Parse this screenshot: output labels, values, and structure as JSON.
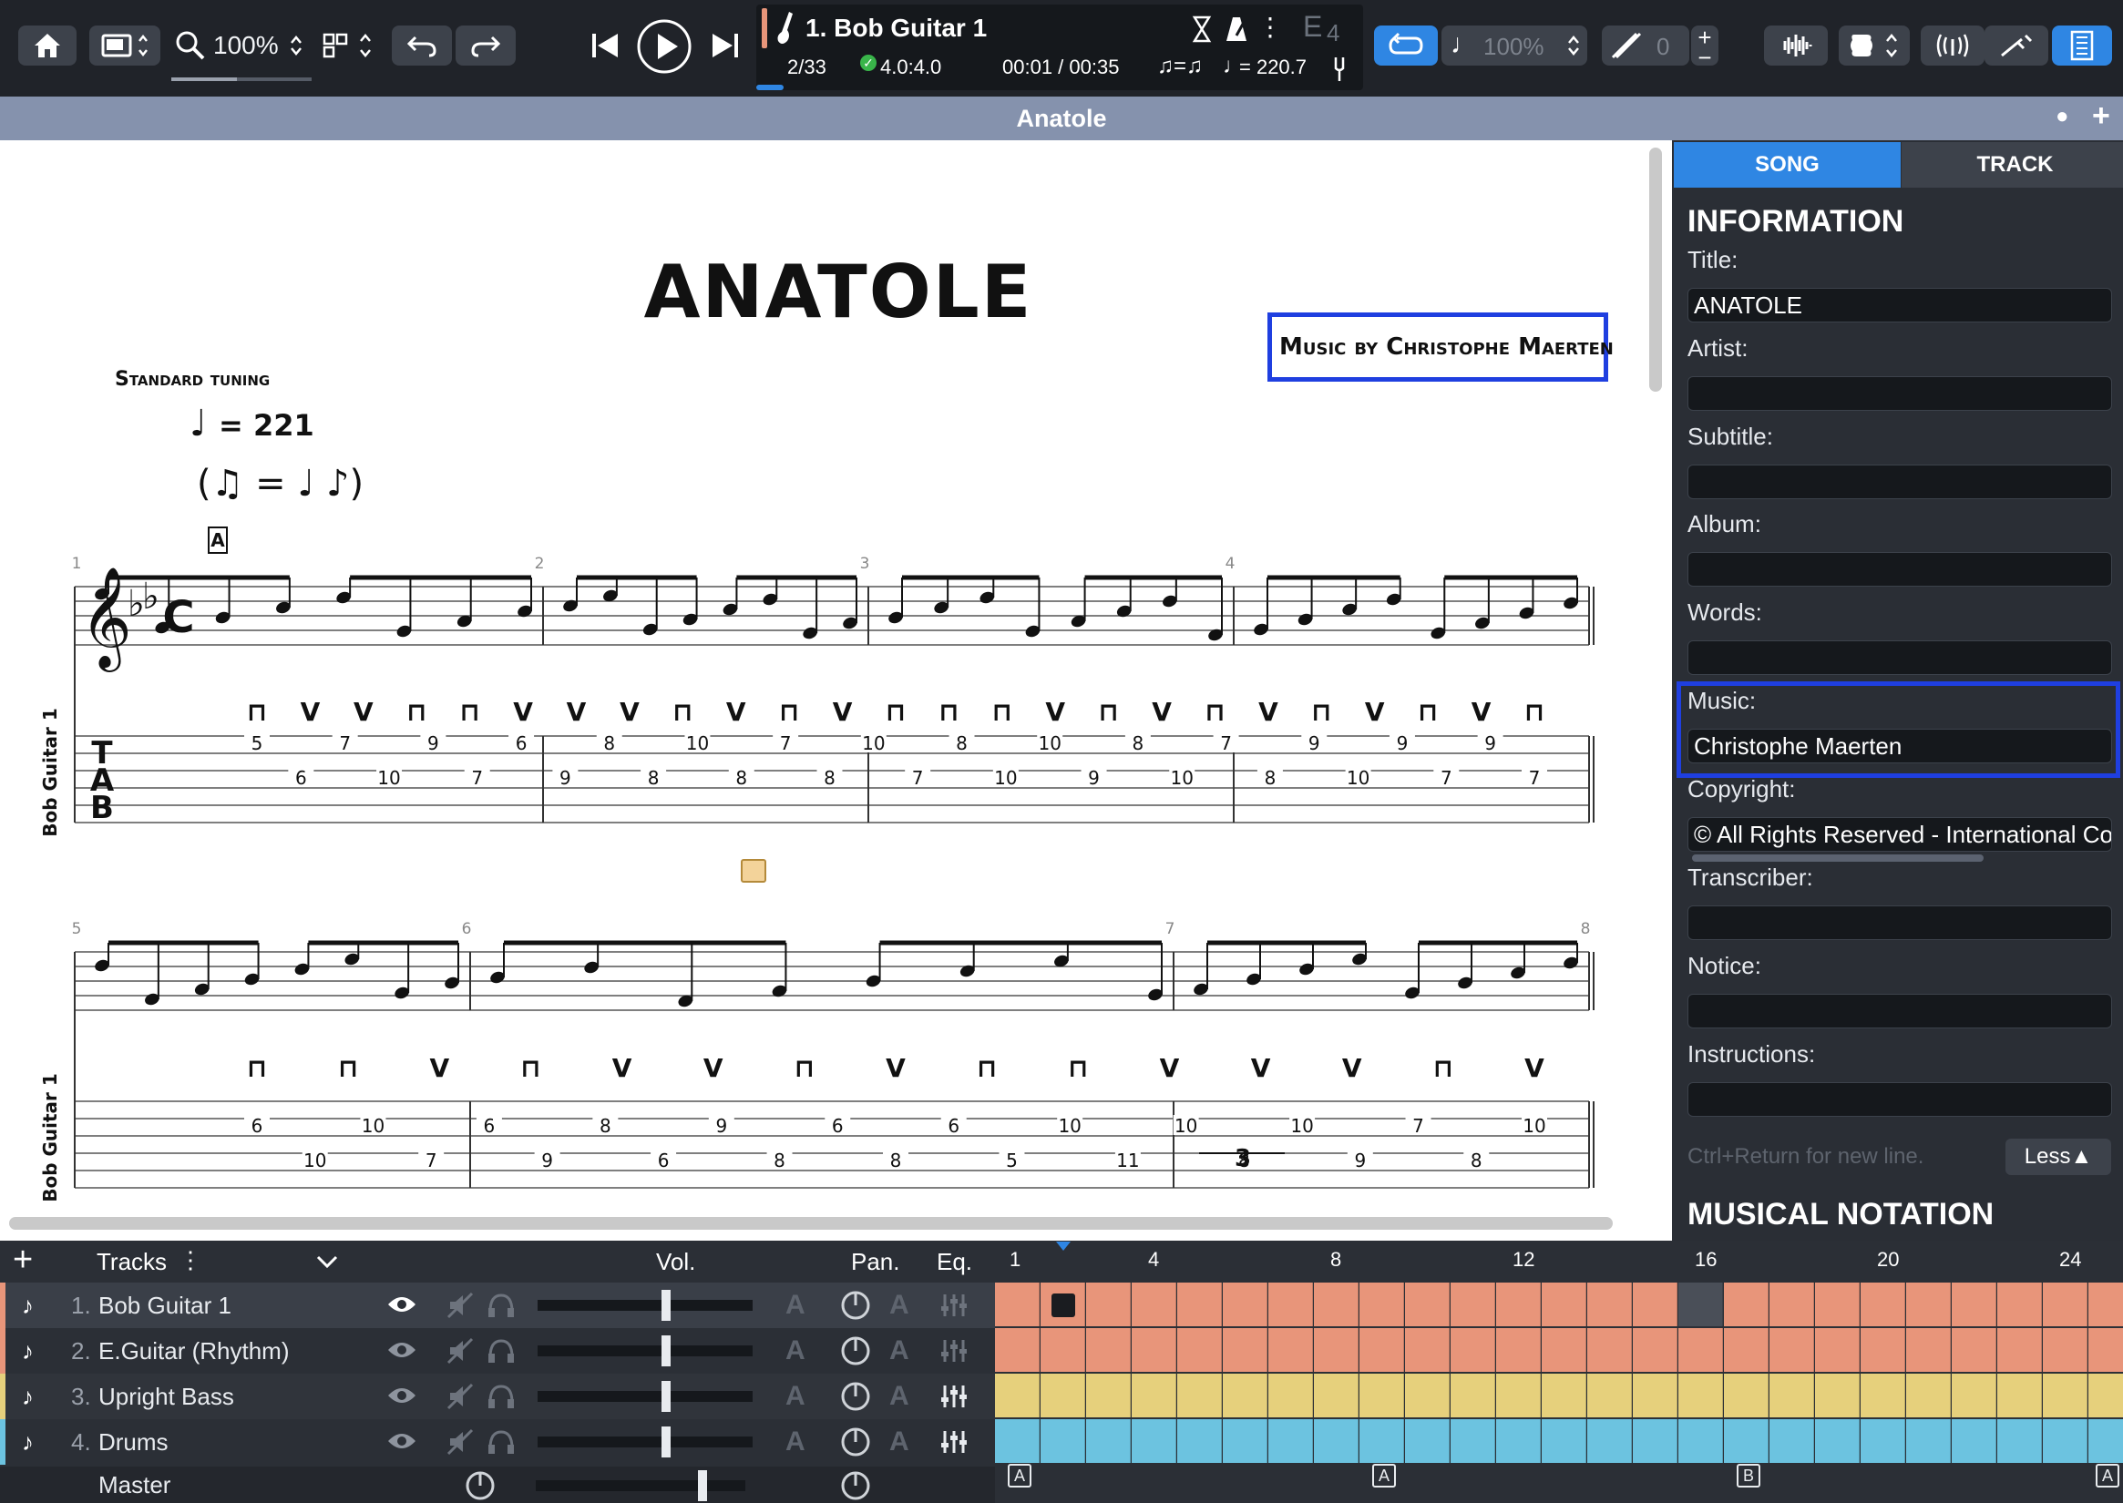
{
  "toolbar": {
    "zoom": "100%",
    "track_title": "1. Bob Guitar 1",
    "bar_position": "2/33",
    "time_signature": "4.0:4.0",
    "time": "00:01 / 00:35",
    "tempo": "= 220.7",
    "key_letter": "E",
    "key_num": "4",
    "speed": "100%",
    "counter": "0"
  },
  "document": {
    "title": "Anatole"
  },
  "score": {
    "title": "ANATOLE",
    "music_by": "Music by Christophe Maerten",
    "tuning": "Standard tuning",
    "tempo": "= 221",
    "section": "A",
    "track_label": "Bob Guitar 1",
    "time_sig": "C",
    "tab_clef": [
      "T",
      "A",
      "B"
    ],
    "triplet": "3",
    "system1": {
      "bar_numbers": [
        "1",
        "2",
        "3",
        "4"
      ],
      "picking": [
        "⊓",
        "V",
        "V",
        "⊓",
        "⊓",
        "V",
        "V",
        "V",
        "⊓",
        "V",
        "⊓",
        "V",
        "⊓",
        "⊓",
        "⊓",
        "V",
        "⊓",
        "V",
        "⊓",
        "V",
        "⊓",
        "V",
        "⊓",
        "V",
        "⊓"
      ],
      "frets": [
        "5",
        "6",
        "7",
        "10",
        "9",
        "7",
        "6",
        "9",
        "8",
        "8",
        "10",
        "8",
        "7",
        "8",
        "10",
        "7",
        "8",
        "10",
        "10",
        "9",
        "8",
        "10",
        "7",
        "8",
        "9",
        "10",
        "9",
        "7",
        "9",
        "7"
      ]
    },
    "system2": {
      "bar_numbers": [
        "5",
        "6",
        "7",
        "8"
      ],
      "picking": [
        "⊓",
        "⊓",
        "V",
        "⊓",
        "V",
        "V",
        "⊓",
        "V",
        "⊓",
        "⊓",
        "V",
        "V",
        "V",
        "⊓",
        "V"
      ],
      "frets": [
        "6",
        "10",
        "10",
        "7",
        "6",
        "9",
        "8",
        "6",
        "9",
        "8",
        "6",
        "8",
        "6",
        "5",
        "10",
        "11",
        "10",
        "8",
        "10",
        "9",
        "7",
        "8",
        "10"
      ]
    }
  },
  "panel": {
    "tabs": [
      "SONG",
      "TRACK"
    ],
    "section_title": "INFORMATION",
    "fields": [
      {
        "label": "Title:",
        "value": "ANATOLE"
      },
      {
        "label": "Artist:",
        "value": ""
      },
      {
        "label": "Subtitle:",
        "value": ""
      },
      {
        "label": "Album:",
        "value": ""
      },
      {
        "label": "Words:",
        "value": ""
      },
      {
        "label": "Music:",
        "value": "Christophe Maerten"
      },
      {
        "label": "Copyright:",
        "value": "© All Rights Reserved - International Co"
      },
      {
        "label": "Transcriber:",
        "value": ""
      },
      {
        "label": "Notice:",
        "value": ""
      },
      {
        "label": "Instructions:",
        "value": ""
      }
    ],
    "hint": "Ctrl+Return for new line.",
    "less_button": "Less▲",
    "notation_title": "MUSICAL NOTATION"
  },
  "tracks": {
    "header": "Tracks",
    "vol_label": "Vol.",
    "pan_label": "Pan.",
    "eq_label": "Eq.",
    "list": [
      {
        "num": "1.",
        "name": "Bob Guitar 1",
        "color": "#e8957a"
      },
      {
        "num": "2.",
        "name": "E.Guitar (Rhythm)",
        "color": "#e8957a"
      },
      {
        "num": "3.",
        "name": "Upright Bass",
        "color": "#e6d07c"
      },
      {
        "num": "4.",
        "name": "Drums",
        "color": "#6cc3e0"
      }
    ],
    "master": "Master",
    "auto_label": "A"
  },
  "timeline": {
    "bar_numbers": [
      "1",
      "4",
      "8",
      "12",
      "16",
      "20",
      "24"
    ],
    "section_markers": [
      "A",
      "A",
      "B",
      "A"
    ]
  },
  "colors": {
    "accent": "#2f86e3",
    "highlight": "#1f3fe0"
  }
}
